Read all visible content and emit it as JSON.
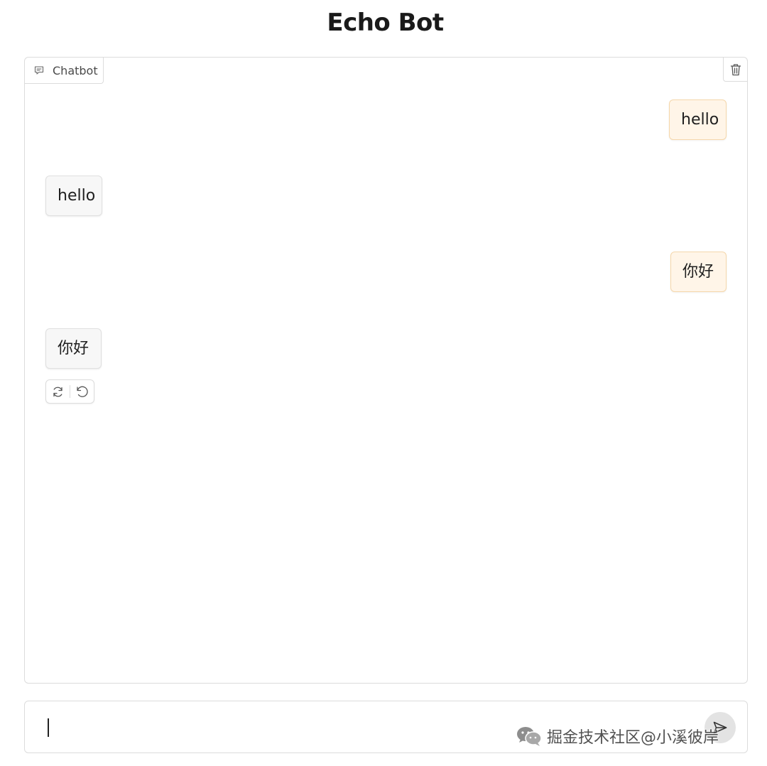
{
  "app": {
    "title": "Echo Bot"
  },
  "chatbot": {
    "tab_label": "Chatbot",
    "tab_icon": "chat-icon",
    "clear_icon": "trash-icon",
    "messages": [
      {
        "role": "user",
        "text": "hello"
      },
      {
        "role": "bot",
        "text": "hello"
      },
      {
        "role": "user",
        "text": "你好"
      },
      {
        "role": "bot",
        "text": "你好"
      }
    ],
    "actions": [
      {
        "icon": "retry-icon"
      },
      {
        "icon": "undo-icon"
      }
    ]
  },
  "input": {
    "value": "",
    "send_icon": "send-icon"
  },
  "watermark": {
    "icon": "wechat-icon",
    "text": "掘金技术社区@小溪彼岸"
  },
  "colors": {
    "user_bubble_bg": "#fff5e8",
    "user_bubble_border": "#f5d7ab",
    "bot_bubble_bg": "#f7f7f7",
    "border": "#dcdcdc"
  }
}
